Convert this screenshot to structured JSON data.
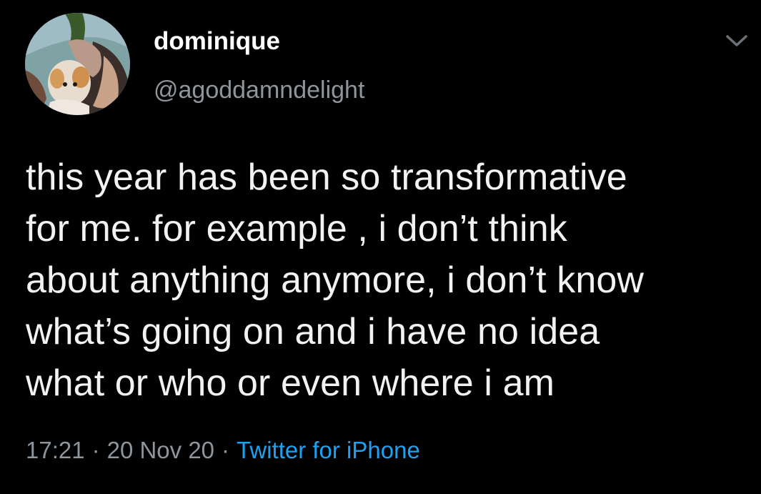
{
  "author": {
    "display_name": "dominique",
    "handle": "@agoddamndelight",
    "avatar_icon": "profile-photo-cat"
  },
  "tweet": {
    "lines": [
      "this year has been so transformative",
      "for me. for example , i don’t think",
      "about anything anymore, i don’t know",
      "what’s going on and i have no idea",
      "what or who or even where i am"
    ]
  },
  "meta": {
    "time": "17:21",
    "separator": "·",
    "date": "20 Nov 20",
    "source": "Twitter for iPhone"
  },
  "colors": {
    "background": "#000000",
    "text": "#f2f2f2",
    "secondary": "#8e959b",
    "link": "#1da1f2"
  },
  "menu_icon": "chevron-down-icon"
}
